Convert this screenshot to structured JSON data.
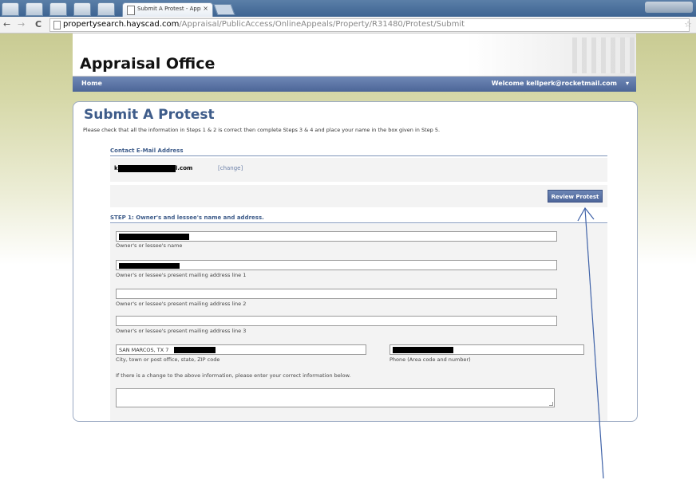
{
  "browser": {
    "tab_title": "Submit A Protest - Appra",
    "tab_close": "×",
    "url_host": "propertysearch.hayscad.com",
    "url_path": "/Appraisal/PublicAccess/OnlineAppeals/Property/R31480/Protest/Submit",
    "back_glyph": "←",
    "forward_glyph": "→",
    "reload_glyph": "C",
    "star_glyph": "☆"
  },
  "site": {
    "title": "Appraisal Office",
    "nav_home": "Home",
    "nav_welcome": "Welcome kellperk@rocketmail.com",
    "nav_caret": "▾"
  },
  "page": {
    "heading": "Submit A Protest",
    "intro": "Please check that all the information in Steps 1 & 2 is correct then complete Steps 3 & 4 and place your name in the box given in Step 5.",
    "contact_label": "Contact E-Mail Address",
    "email_prefix": "k",
    "email_suffix": "l.com",
    "change_link": "[change]",
    "review_button": "Review Protest",
    "step1_label": "STEP 1: Owner's and lessee's name and address.",
    "fields": {
      "name_caption": "Owner's or lessee's name",
      "addr1_caption": "Owner's or lessee's present mailing address line 1",
      "addr2_caption": "Owner's or lessee's present mailing address line 2",
      "addr3_caption": "Owner's or lessee's present mailing address line 3",
      "city_value": "SAN MARCOS, TX 7",
      "city_caption": "City, town or post office, state, ZIP code",
      "phone_caption": "Phone (Area code and number)",
      "change_note": "If there is a change to the above information, please enter your correct information below."
    }
  },
  "colors": {
    "accent": "#3e5c8a",
    "navbar": "#4c6597",
    "annotation_arrow": "#3f62a8"
  }
}
